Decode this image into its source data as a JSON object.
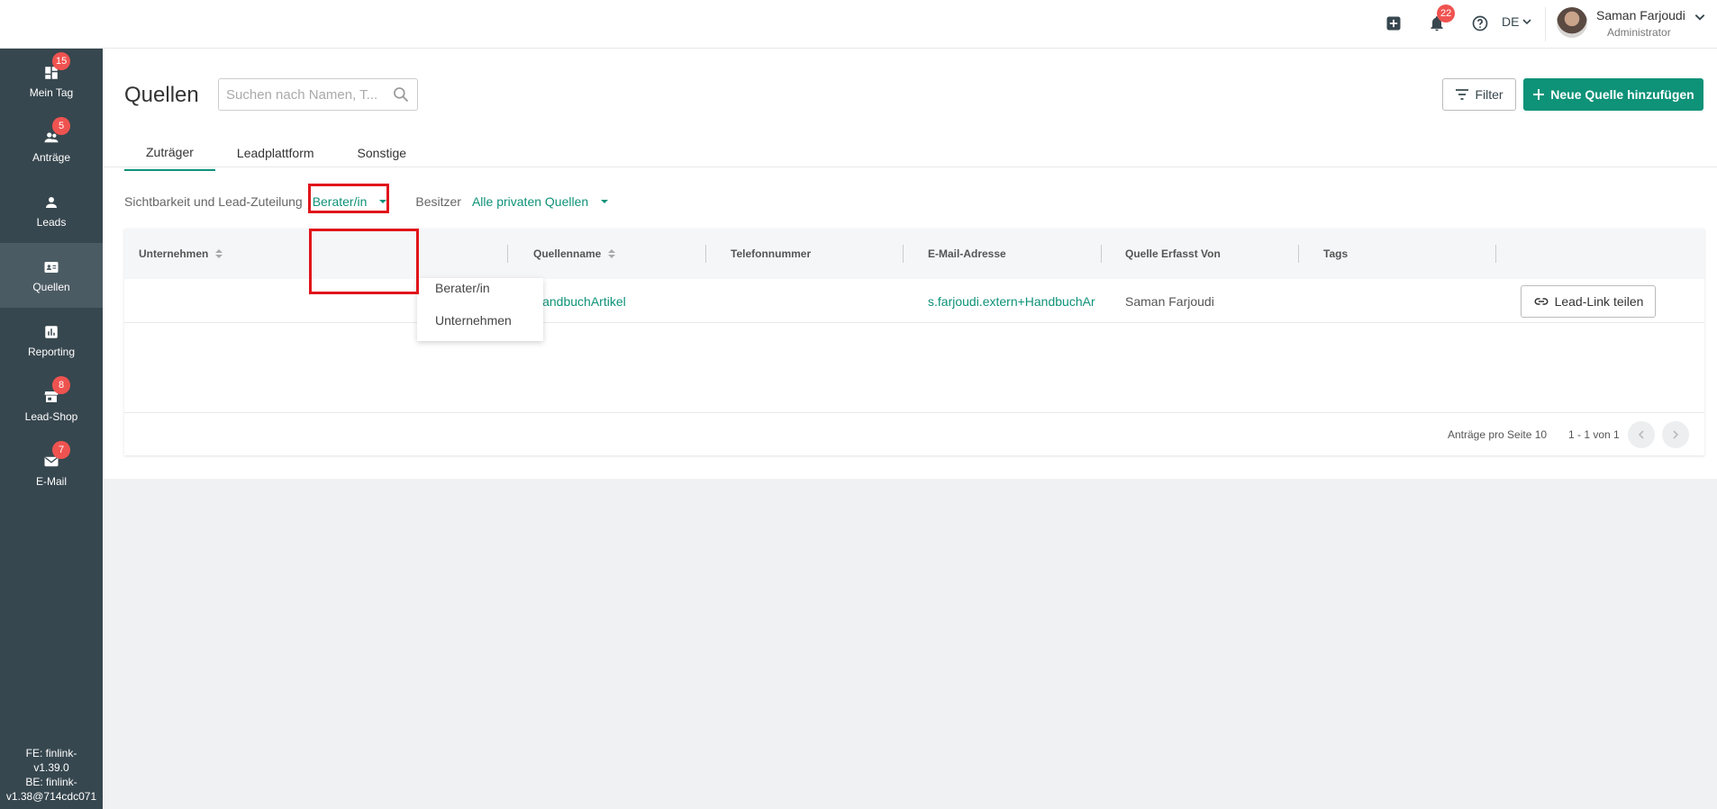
{
  "topbar": {
    "notification_count": "22",
    "language": "DE",
    "user": {
      "name": "Saman Farjoudi",
      "role": "Administrator"
    }
  },
  "sidebar": {
    "items": [
      {
        "label": "Mein Tag",
        "badge": "15",
        "icon": "dashboard-icon"
      },
      {
        "label": "Anträge",
        "badge": "5",
        "icon": "people-icon"
      },
      {
        "label": "Leads",
        "badge": "",
        "icon": "person-icon"
      },
      {
        "label": "Quellen",
        "badge": "",
        "icon": "contact-card-icon",
        "active": true
      },
      {
        "label": "Reporting",
        "badge": "",
        "icon": "chart-icon"
      },
      {
        "label": "Lead-Shop",
        "badge": "8",
        "icon": "store-icon"
      },
      {
        "label": "E-Mail",
        "badge": "7",
        "icon": "mail-icon"
      }
    ],
    "version": [
      "FE: finlink-",
      "v1.39.0",
      "BE: finlink-",
      "v1.38@714cdc071"
    ]
  },
  "page": {
    "title": "Quellen",
    "search_placeholder": "Suchen nach Namen, T...",
    "filter_label": "Filter",
    "add_label": "Neue Quelle hinzufügen"
  },
  "tabs": [
    "Zuträger",
    "Leadplattform",
    "Sonstige"
  ],
  "filters": {
    "visibility_label": "Sichtbarkeit und Lead-Zuteilung",
    "visibility_value": "Berater/in",
    "owner_label": "Besitzer",
    "owner_value": "Alle privaten Quellen"
  },
  "dropdown_options": [
    "Berater/in",
    "Unternehmen"
  ],
  "table": {
    "columns": [
      "Unternehmen",
      "Quellenname",
      "Telefonnummer",
      "E-Mail-Adresse",
      "Quelle Erfasst Von",
      "Tags"
    ],
    "rows": [
      {
        "unternehmen": "",
        "quellenname": "HandbuchArtikel",
        "telefon": "",
        "email": "s.farjoudi.extern+HandbuchAr",
        "erfasst_von": "Saman Farjoudi",
        "tags": "",
        "action": "Lead-Link teilen"
      }
    ],
    "footer": {
      "per_page_label": "Anträge pro Seite 10",
      "range": "1 - 1 von 1"
    }
  },
  "colors": {
    "accent": "#0e9278",
    "sidebar": "#37474f",
    "badge": "#ef5350",
    "highlight": "#e0151b"
  }
}
